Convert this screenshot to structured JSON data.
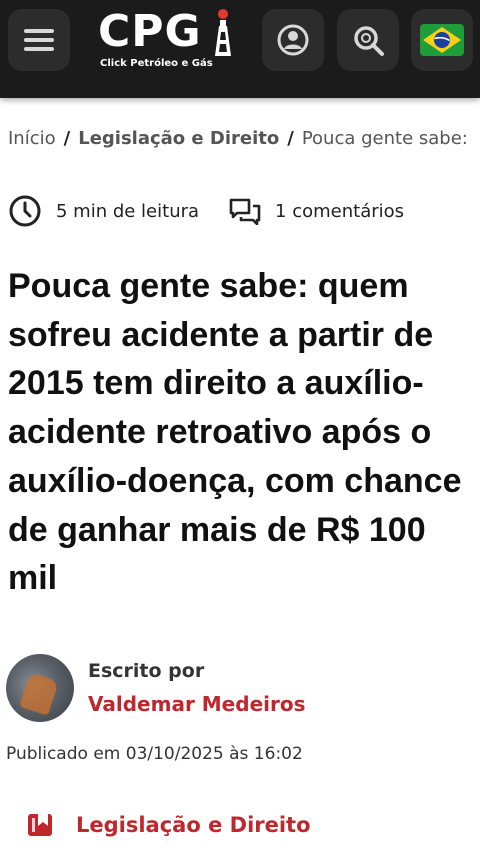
{
  "header": {
    "logo_text": "CPG",
    "logo_subtitle": "Click Petróleo e Gás",
    "menu_icon": "hamburger-menu-icon",
    "user_icon": "user-icon",
    "search_icon": "search-icon",
    "flag_icon": "brazil-flag-icon"
  },
  "breadcrumb": {
    "home": "Início",
    "separator": "/",
    "category": "Legislação e Direito",
    "current": "Pouca gente sabe:"
  },
  "meta": {
    "read_time": "5 min de leitura",
    "comments": "1 comentários"
  },
  "article": {
    "title": "Pouca gente sabe: quem sofreu acidente a partir de 2015 tem direito a auxílio-acidente retroativo após o auxílio-doença, com chance de ganhar mais de R$ 100 mil"
  },
  "author": {
    "label": "Escrito por",
    "name": "Valdemar Medeiros"
  },
  "published": "Publicado em 03/10/2025 às 16:02",
  "category": {
    "label": "Legislação e Direito"
  },
  "colors": {
    "topbar": "#1b1b1b",
    "accent": "#c0272d"
  }
}
